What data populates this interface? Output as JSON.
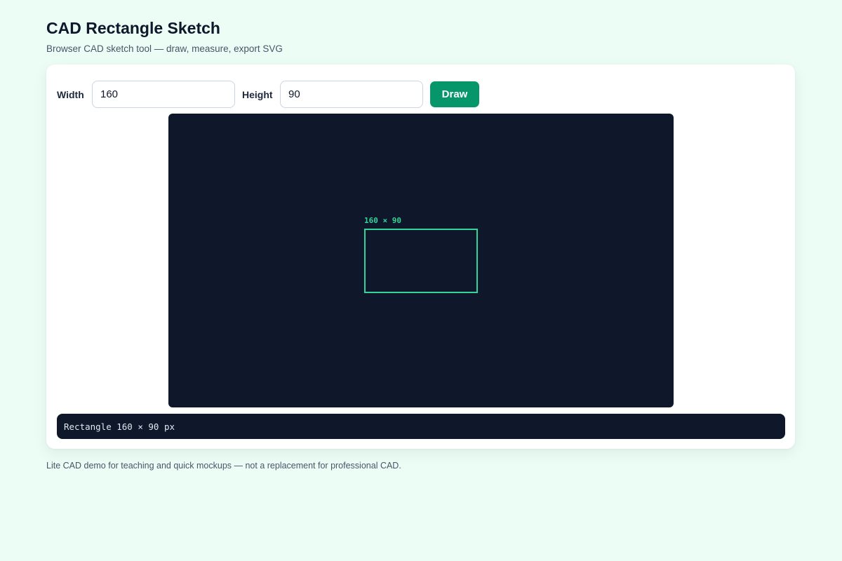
{
  "header": {
    "title": "CAD Rectangle Sketch",
    "subtitle": "Browser CAD sketch tool — draw, measure, export SVG"
  },
  "controls": {
    "width_label": "Width",
    "width_value": "160",
    "height_label": "Height",
    "height_value": "90",
    "draw_label": "Draw"
  },
  "canvas": {
    "background": "#0f172a",
    "stroke_color": "#34d399",
    "rectangle": {
      "width": 160,
      "height": 90,
      "dimension_label": "160 × 90"
    }
  },
  "status": {
    "text": "Rectangle 160 × 90 px"
  },
  "footer": {
    "note": "Lite CAD demo for teaching and quick mockups — not a replacement for professional CAD."
  },
  "colors": {
    "page_background": "#ecfdf5",
    "accent": "#059669"
  }
}
